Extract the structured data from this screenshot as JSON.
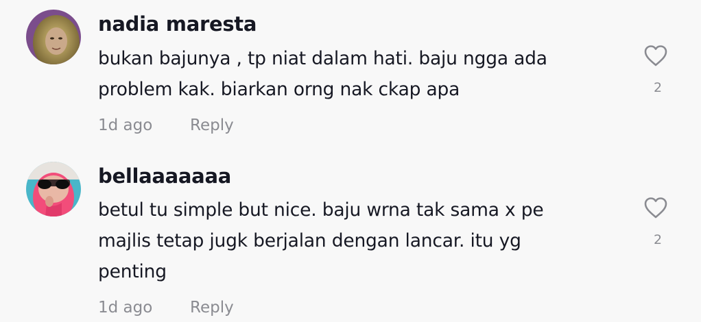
{
  "comments": [
    {
      "username": "nadia maresta",
      "text": "bukan bajunya , tp niat dalam hati. baju ngga ada problem kak. biarkan orng nak ckap apa",
      "time": "1d ago",
      "reply_label": "Reply",
      "likes": "2",
      "avatar_icon": "avatar-photo-icon",
      "like_icon": "heart-outline-icon"
    },
    {
      "username": "bellaaaaaaa",
      "text": "betul tu simple but nice. baju wrna tak sama x pe majlis tetap jugk berjalan dengan lancar. itu yg penting",
      "time": "1d ago",
      "reply_label": "Reply",
      "likes": "2",
      "avatar_icon": "avatar-photo-icon",
      "like_icon": "heart-outline-icon"
    }
  ],
  "colors": {
    "background": "#f8f8f8",
    "primary_text": "#161823",
    "secondary_text": "#8a8b91"
  }
}
